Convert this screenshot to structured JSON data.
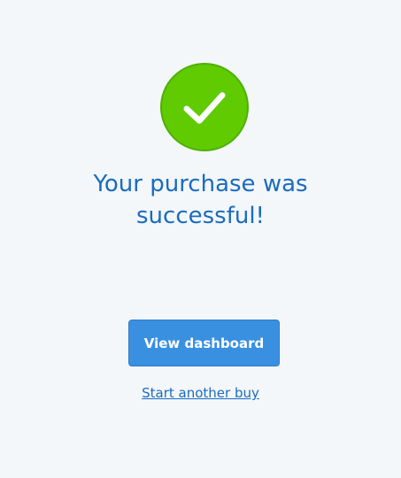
{
  "status": {
    "icon": "checkmark-icon",
    "color": "#5fcb00"
  },
  "message": {
    "line1": "Your purchase was",
    "line2": "successful!"
  },
  "actions": {
    "primary_label": "View dashboard",
    "secondary_label": "Start another buy"
  },
  "colors": {
    "accent": "#3a90e0",
    "heading": "#1b6bbf",
    "background": "#f3f7fa"
  }
}
